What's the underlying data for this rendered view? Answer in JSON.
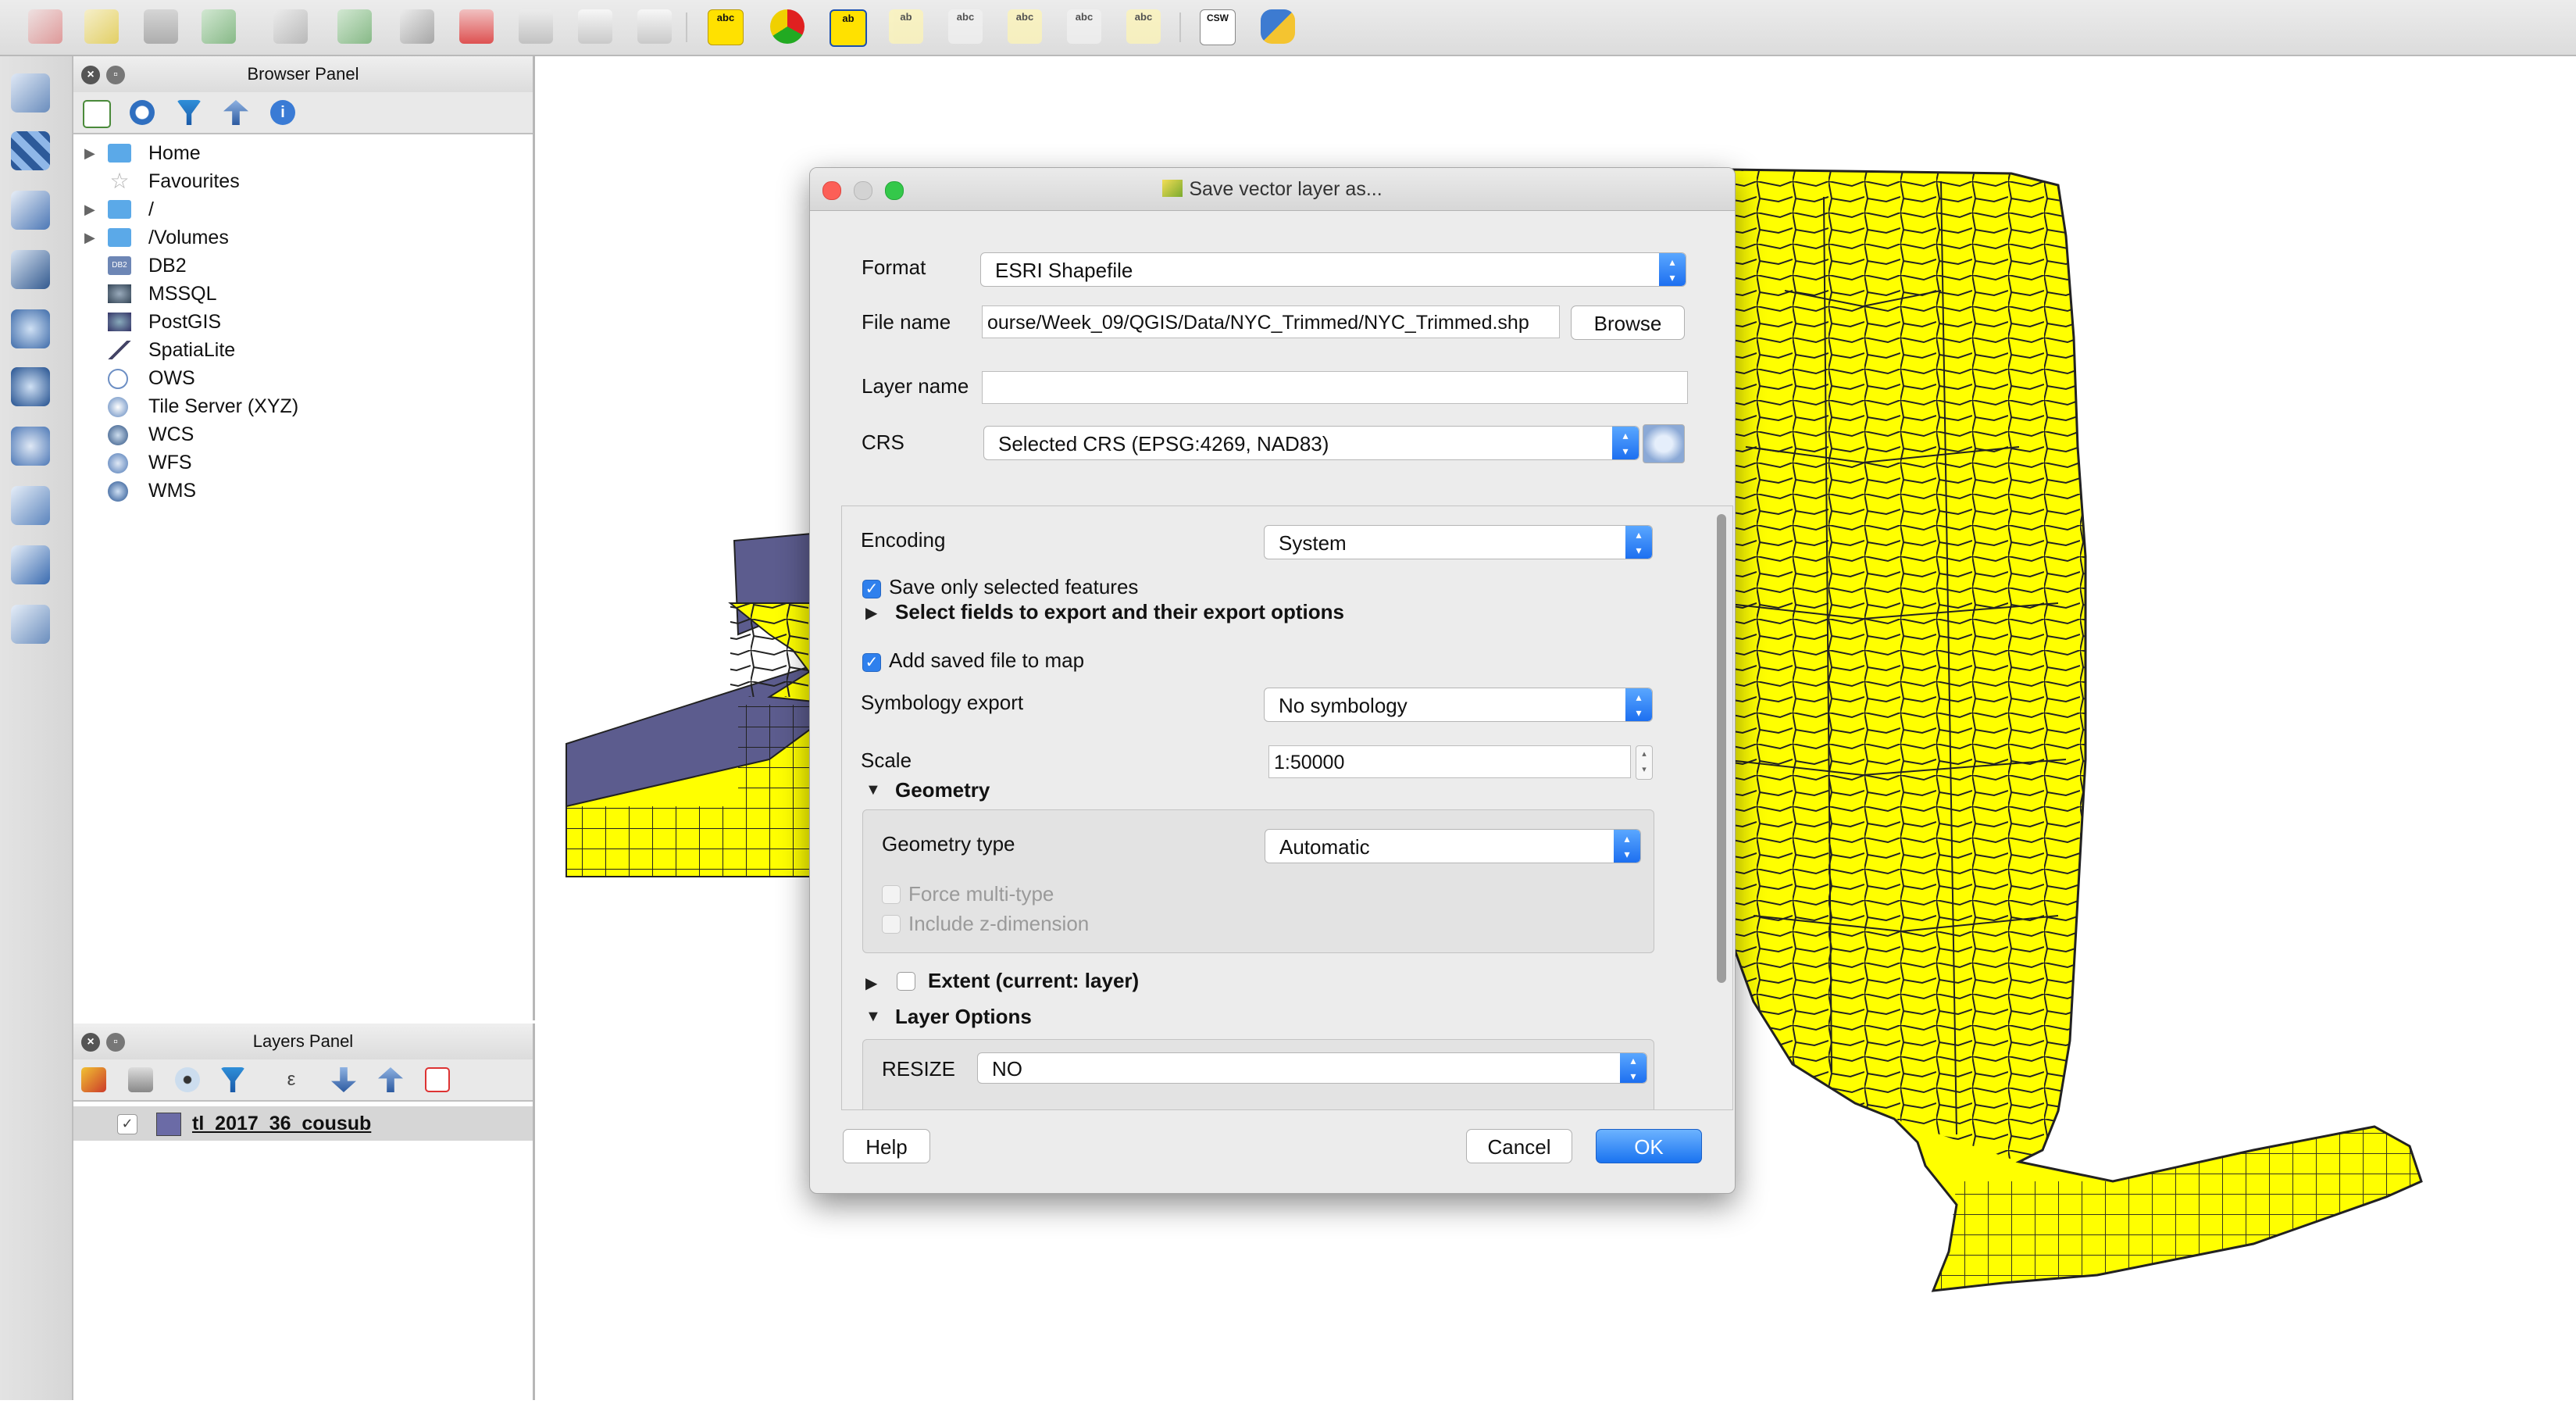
{
  "browser_panel": {
    "title": "Browser Panel",
    "items": [
      {
        "label": "Home",
        "icon": "folder-icon",
        "expandable": true
      },
      {
        "label": "Favourites",
        "icon": "star-icon",
        "expandable": false
      },
      {
        "label": "/",
        "icon": "folder-icon",
        "expandable": true
      },
      {
        "label": "/Volumes",
        "icon": "folder-icon",
        "expandable": true
      },
      {
        "label": "DB2",
        "icon": "db2-icon",
        "expandable": false
      },
      {
        "label": "MSSQL",
        "icon": "mssql-icon",
        "expandable": false
      },
      {
        "label": "PostGIS",
        "icon": "postgis-icon",
        "expandable": false
      },
      {
        "label": "SpatiaLite",
        "icon": "spatialite-icon",
        "expandable": false
      },
      {
        "label": "OWS",
        "icon": "ows-globe-icon",
        "expandable": false
      },
      {
        "label": "Tile Server (XYZ)",
        "icon": "xyz-globe-icon",
        "expandable": false
      },
      {
        "label": "WCS",
        "icon": "wcs-icon",
        "expandable": false
      },
      {
        "label": "WFS",
        "icon": "wfs-icon",
        "expandable": false
      },
      {
        "label": "WMS",
        "icon": "wms-icon",
        "expandable": false
      }
    ]
  },
  "layers_panel": {
    "title": "Layers Panel",
    "layers": [
      {
        "name": "tl_2017_36_cousub",
        "visible": true,
        "color": "#6b6ba6"
      }
    ]
  },
  "dialog": {
    "title": "Save vector layer as...",
    "format_label": "Format",
    "format_value": "ESRI Shapefile",
    "filename_label": "File name",
    "filename_value": "ourse/Week_09/QGIS/Data/NYC_Trimmed/NYC_Trimmed.shp",
    "browse_label": "Browse",
    "layername_label": "Layer name",
    "layername_value": "",
    "crs_label": "CRS",
    "crs_value": "Selected CRS (EPSG:4269, NAD83)",
    "encoding_label": "Encoding",
    "encoding_value": "System",
    "save_selected_label": "Save only selected features",
    "save_selected_checked": true,
    "select_fields_label": "Select fields to export and their export options",
    "add_to_map_label": "Add saved file to map",
    "add_to_map_checked": true,
    "symbology_label": "Symbology export",
    "symbology_value": "No symbology",
    "scale_label": "Scale",
    "scale_value": "1:50000",
    "geometry_section": "Geometry",
    "geometry_type_label": "Geometry type",
    "geometry_type_value": "Automatic",
    "force_multi_label": "Force multi-type",
    "include_z_label": "Include z-dimension",
    "extent_label": "Extent (current: layer)",
    "layer_options_label": "Layer Options",
    "resize_label": "RESIZE",
    "resize_value": "NO",
    "help_label": "Help",
    "cancel_label": "Cancel",
    "ok_label": "OK"
  },
  "colors": {
    "map_fill": "#ffff00",
    "map_stroke": "#222222",
    "layer_fill": "#5c5c8e",
    "accent": "#1d6ff0"
  }
}
